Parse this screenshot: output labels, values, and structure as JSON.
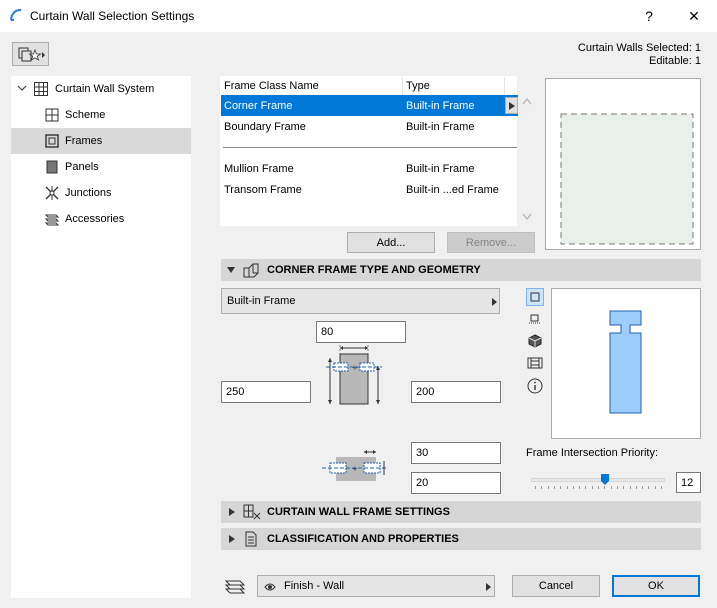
{
  "window": {
    "title": "Curtain Wall Selection Settings",
    "help": "?",
    "close": "✕"
  },
  "selection": {
    "selected": "Curtain Walls Selected: 1",
    "editable": "Editable: 1"
  },
  "tree": {
    "root": "Curtain Wall System",
    "items": [
      "Scheme",
      "Frames",
      "Panels",
      "Junctions",
      "Accessories"
    ],
    "selected": "Frames"
  },
  "frame_list": {
    "headers": {
      "name": "Frame Class Name",
      "type": "Type"
    },
    "rows": [
      {
        "name": "Corner Frame",
        "type": "Built-in Frame",
        "selected": true
      },
      {
        "name": "Boundary Frame",
        "type": "Built-in Frame"
      },
      {
        "name": "Mullion Frame",
        "type": "Built-in Frame"
      },
      {
        "name": "Transom Frame",
        "type": "Built-in ...ed Frame"
      }
    ],
    "add": "Add...",
    "remove": "Remove..."
  },
  "corner_section": {
    "title": "CORNER FRAME TYPE AND GEOMETRY",
    "type_combo": "Built-in Frame",
    "width": "80",
    "depth_left": "250",
    "depth_right": "200",
    "offset_a": "30",
    "offset_b": "20",
    "priority_label": "Frame Intersection Priority:",
    "priority_value": "12",
    "priority_fraction": 0.55
  },
  "sections": {
    "cw_frame": "CURTAIN WALL FRAME SETTINGS",
    "classification": "CLASSIFICATION AND PROPERTIES"
  },
  "footer": {
    "layer_combo": "Finish - Wall",
    "cancel": "Cancel",
    "ok": "OK"
  },
  "colors": {
    "accent": "#0078d7",
    "frame_fill": "#9fcdfb",
    "frame_stroke": "#1f5fb0"
  }
}
